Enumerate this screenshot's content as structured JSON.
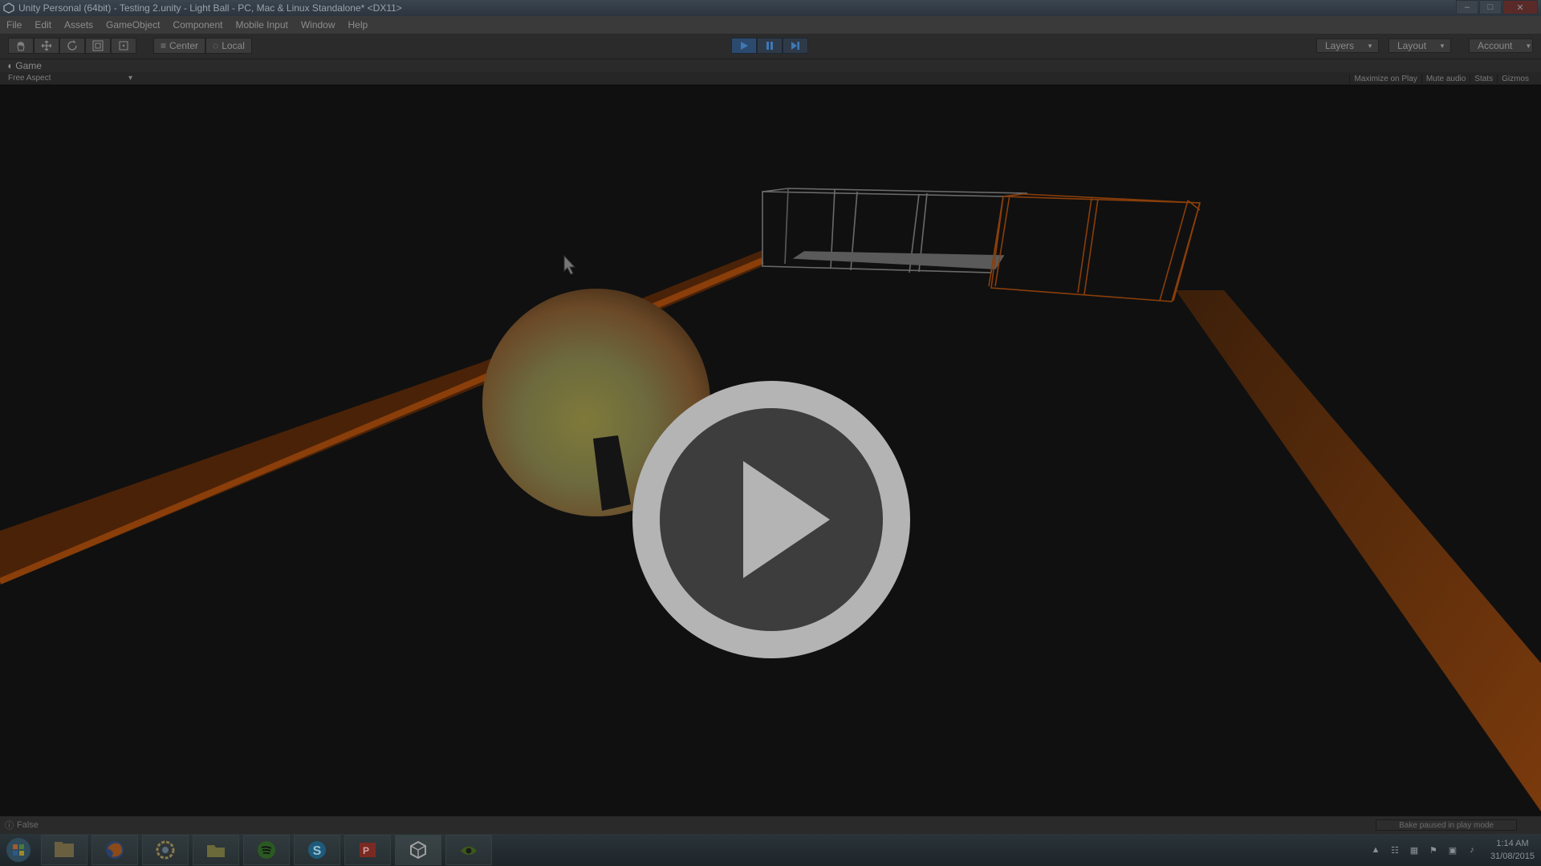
{
  "window": {
    "title": "Unity Personal (64bit) - Testing 2.unity - Light Ball - PC, Mac & Linux Standalone* <DX11>"
  },
  "menu": [
    "File",
    "Edit",
    "Assets",
    "GameObject",
    "Component",
    "Mobile Input",
    "Window",
    "Help"
  ],
  "toolbar": {
    "transform_tools": [
      "hand-icon",
      "move-icon",
      "rotate-icon",
      "scale-icon",
      "rect-icon"
    ],
    "pivot_label": "Center",
    "space_label": "Local",
    "play_state": "playing",
    "layers_label": "Layers",
    "layout_label": "Layout",
    "account_label": "Account"
  },
  "game_view": {
    "tab_label": "Game",
    "aspect_label": "Free Aspect",
    "options": [
      "Maximize on Play",
      "Mute audio",
      "Stats",
      "Gizmos"
    ]
  },
  "status": {
    "message": "False",
    "bake_label": "Bake paused in play mode"
  },
  "taskbar": {
    "apps": [
      "file-explorer-icon",
      "firefox-icon",
      "settings-icon",
      "folder-icon",
      "spotify-icon",
      "skype-icon",
      "powerpoint-icon",
      "unity-icon",
      "nvidia-icon"
    ],
    "time": "1:14 AM",
    "date": "31/08/2015"
  },
  "colors": {
    "accent_orange": "#b85412",
    "play_blue": "#2c4a6e",
    "overlay_ring": "#c8c8c8"
  }
}
